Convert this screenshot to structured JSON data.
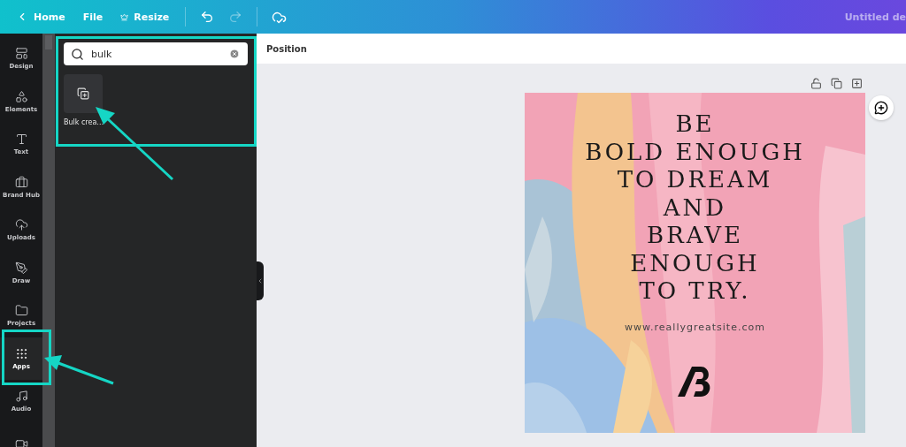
{
  "top_bar": {
    "menu": [
      {
        "label": "Home"
      },
      {
        "label": "File"
      },
      {
        "label": "Resize"
      }
    ],
    "history": [
      {
        "disabled": false
      },
      {
        "disabled": true
      }
    ],
    "title": "Untitled de"
  },
  "rail": [
    {
      "label": "Design",
      "selected": false
    },
    {
      "label": "Elements",
      "selected": false
    },
    {
      "label": "Text",
      "selected": false
    },
    {
      "label": "Brand Hub",
      "selected": false
    },
    {
      "label": "Uploads",
      "selected": false
    },
    {
      "label": "Draw",
      "selected": false
    },
    {
      "label": "Projects",
      "selected": false
    },
    {
      "label": "Apps",
      "selected": true
    },
    {
      "label": "Audio",
      "selected": false
    },
    {
      "selected": false
    }
  ],
  "panel": {
    "search": {
      "value": "bulk"
    },
    "results": [
      {
        "label": "Bulk crea…"
      }
    ]
  },
  "toolbar": {
    "label": "Position"
  },
  "design": {
    "lines": [
      "BE",
      "BOLD ENOUGH",
      "TO DREAM",
      "AND",
      "BRAVE",
      "ENOUGH",
      "TO TRY."
    ],
    "url": "www.reallygreatsite.com"
  }
}
